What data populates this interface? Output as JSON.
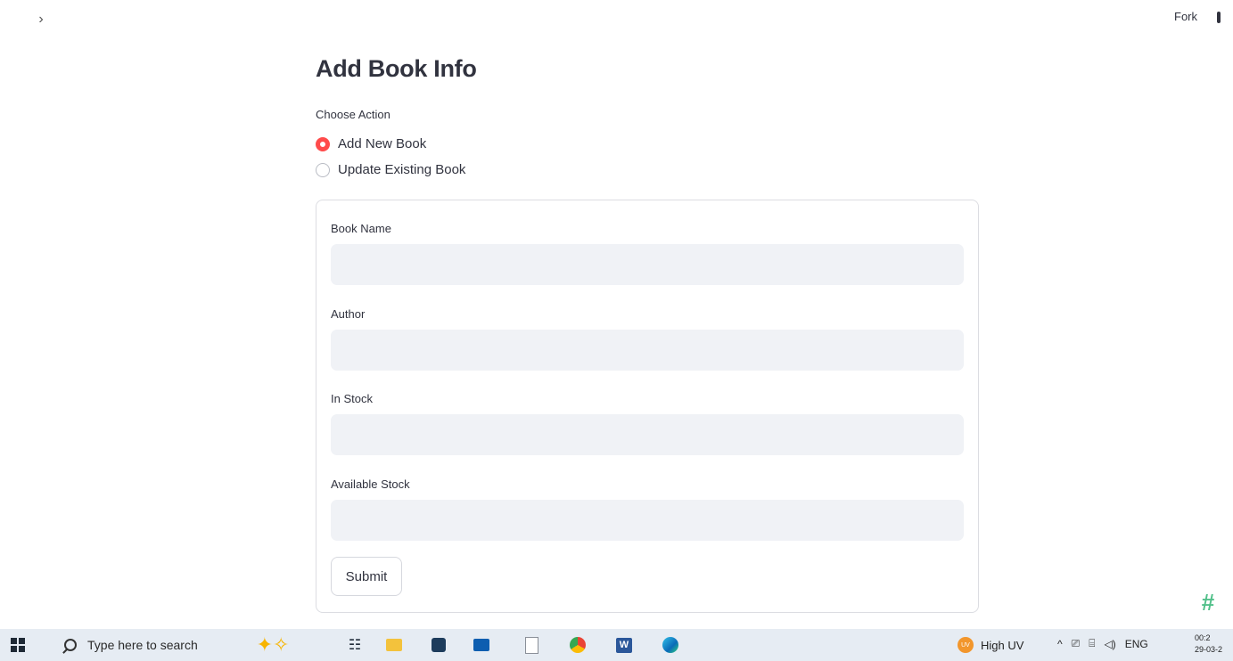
{
  "topbar": {
    "collapse_glyph": "›",
    "fork_label": "Fork"
  },
  "main": {
    "title": "Add Book Info",
    "action": {
      "label": "Choose Action",
      "options": [
        {
          "label": "Add New Book",
          "selected": true
        },
        {
          "label": "Update Existing Book",
          "selected": false
        }
      ]
    },
    "form": {
      "fields": [
        {
          "label": "Book Name",
          "value": ""
        },
        {
          "label": "Author",
          "value": ""
        },
        {
          "label": "In Stock",
          "value": ""
        },
        {
          "label": "Available Stock",
          "value": ""
        }
      ],
      "submit_label": "Submit"
    }
  },
  "taskbar": {
    "search_placeholder": "Type here to search",
    "weather": {
      "badge": "UV",
      "text": "High UV"
    },
    "tray": {
      "chevron": "^",
      "language": "ENG"
    },
    "clock": {
      "time": "00:2",
      "date": "29-03-2"
    }
  },
  "icons": [
    "chevron-right-icon",
    "windows-start-icon",
    "search-icon",
    "copilot-sparkle-icon",
    "task-view-icon",
    "file-explorer-icon",
    "store-icon",
    "mail-icon",
    "notepad-icon",
    "chrome-icon",
    "word-icon",
    "edge-icon",
    "uv-weather-icon",
    "tray-chevron-icon",
    "network-icon",
    "volume-icon"
  ],
  "colors": {
    "accent": "#ff4b4b",
    "input_bg": "#f0f2f6",
    "taskbar_bg": "#e6ecf3"
  }
}
